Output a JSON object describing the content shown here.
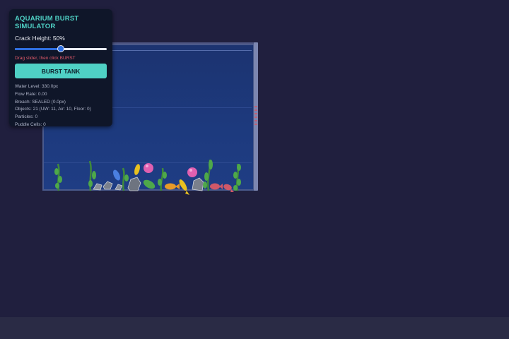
{
  "panel": {
    "title": "AQUARIUM BURST SIMULATOR",
    "crack_label": "Crack Height: 50%",
    "crack_height_percent": 50,
    "hint": "Drag slider, then click BURST",
    "burst_button": "BURST TANK",
    "stats": {
      "water_level": "Water Level: 330.0px",
      "flow_rate": "Flow Rate: 0.00",
      "breach": "Breach: SEALED (0.0px)",
      "objects": "Objects: 21 (UW: 11, Air: 10, Floor: 0)",
      "particles": "Particles: 0",
      "puddle_cells": "Puddle Cells: 0"
    }
  },
  "colors": {
    "background": "#201f3e",
    "accent": "#4fd1c5",
    "hint": "#e05a6a",
    "water": "#1d3a7e",
    "slider": "#2f6fe0"
  },
  "tank": {
    "objects": [
      {
        "kind": "plant",
        "name": "plant-1"
      },
      {
        "kind": "plant",
        "name": "plant-2"
      },
      {
        "kind": "rock",
        "name": "rock-1"
      },
      {
        "kind": "rock",
        "name": "rock-2"
      },
      {
        "kind": "fish-blue",
        "name": "fish-1"
      },
      {
        "kind": "rock",
        "name": "rock-3"
      },
      {
        "kind": "plant",
        "name": "plant-3"
      },
      {
        "kind": "fish-yellow",
        "name": "fish-2"
      },
      {
        "kind": "bubble",
        "name": "bubble-1"
      },
      {
        "kind": "rock",
        "name": "rock-4"
      },
      {
        "kind": "fish-green",
        "name": "fish-3"
      },
      {
        "kind": "plant",
        "name": "plant-4"
      },
      {
        "kind": "fish-orange",
        "name": "fish-4"
      },
      {
        "kind": "fish-yellow",
        "name": "fish-5"
      },
      {
        "kind": "bubble",
        "name": "bubble-2"
      },
      {
        "kind": "rock",
        "name": "rock-5"
      },
      {
        "kind": "plant",
        "name": "plant-5"
      },
      {
        "kind": "fish-red",
        "name": "fish-6"
      },
      {
        "kind": "fish-red",
        "name": "fish-7"
      },
      {
        "kind": "plant",
        "name": "plant-6"
      },
      {
        "kind": "plant",
        "name": "plant-7"
      }
    ]
  }
}
